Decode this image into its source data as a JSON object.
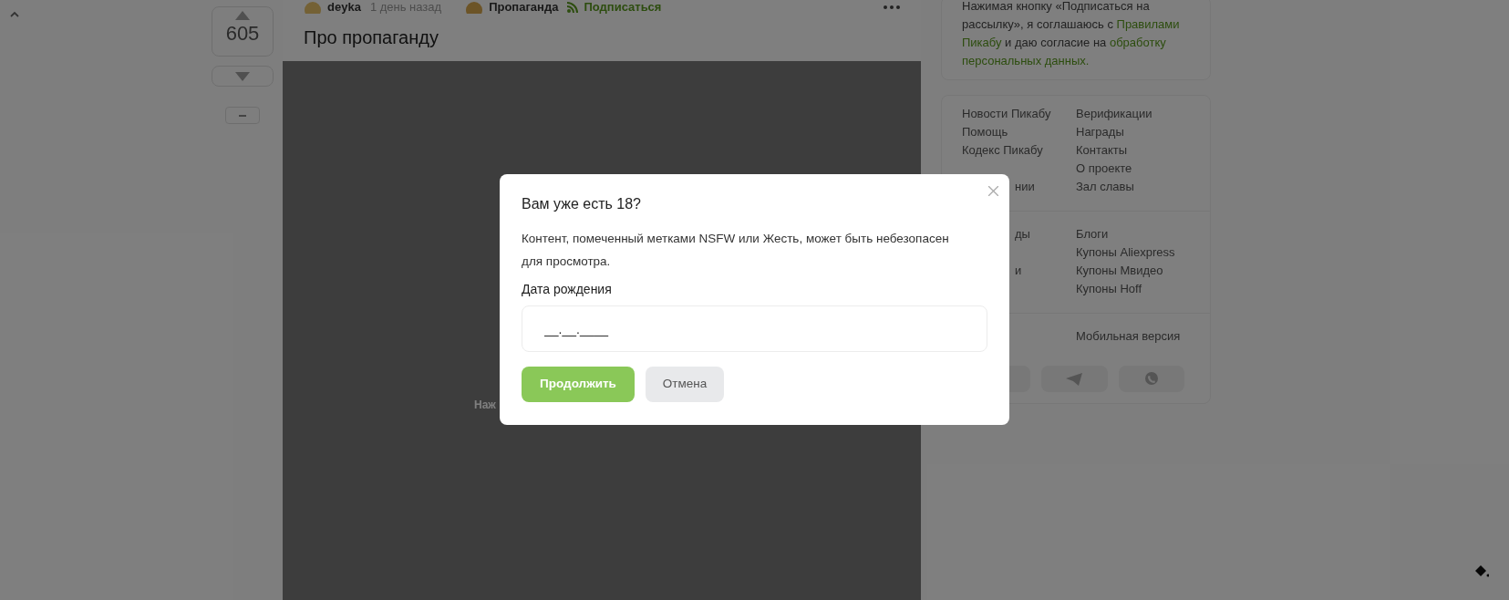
{
  "vote": {
    "score": "605"
  },
  "post": {
    "author": "deyka",
    "time": "1 день назад",
    "community": "Пропаганда",
    "subscribe": "Подписаться",
    "title": "Про пропаганду",
    "media_text": "Наж"
  },
  "notice": [
    {
      "text": "Нажимая кнопку «Подписаться на рассылку», я соглашаюсь с ",
      "link": false
    },
    {
      "text": "Правилами Пикабу",
      "link": true
    },
    {
      "text": " и даю согласие на ",
      "link": false
    },
    {
      "text": "обработку персональных данных.",
      "link": true
    }
  ],
  "footer_groups": [
    {
      "rows": [
        {
          "left": "Новости Пикабу",
          "right": "Верификации"
        },
        {
          "left": "Помощь",
          "right": "Награды"
        },
        {
          "left": "Кодекс Пикабу",
          "right": "Контакты"
        },
        {
          "right": "О проекте"
        },
        {
          "left_fragment": "нии",
          "right": "Зал славы"
        }
      ]
    },
    {
      "rows": [
        {
          "left_fragment": "ды",
          "right": "Блоги"
        },
        {
          "right": "Купоны Aliexpress"
        },
        {
          "left_fragment": "и",
          "right": "Купоны Мвидео"
        },
        {
          "right": "Купоны Hoff"
        }
      ]
    },
    {
      "rows": [
        {
          "right": "Мобильная версия"
        }
      ]
    }
  ],
  "modal": {
    "title": "Вам уже есть 18?",
    "text": "Контент, помеченный метками NSFW или Жесть, может быть небезопасен для просмотра.",
    "field_label": "Дата рождения",
    "field_placeholder": "__.__.____",
    "buttons": [
      {
        "label": "Продолжить",
        "kind": "primary"
      },
      {
        "label": "Отмена",
        "kind": "secondary"
      }
    ]
  }
}
